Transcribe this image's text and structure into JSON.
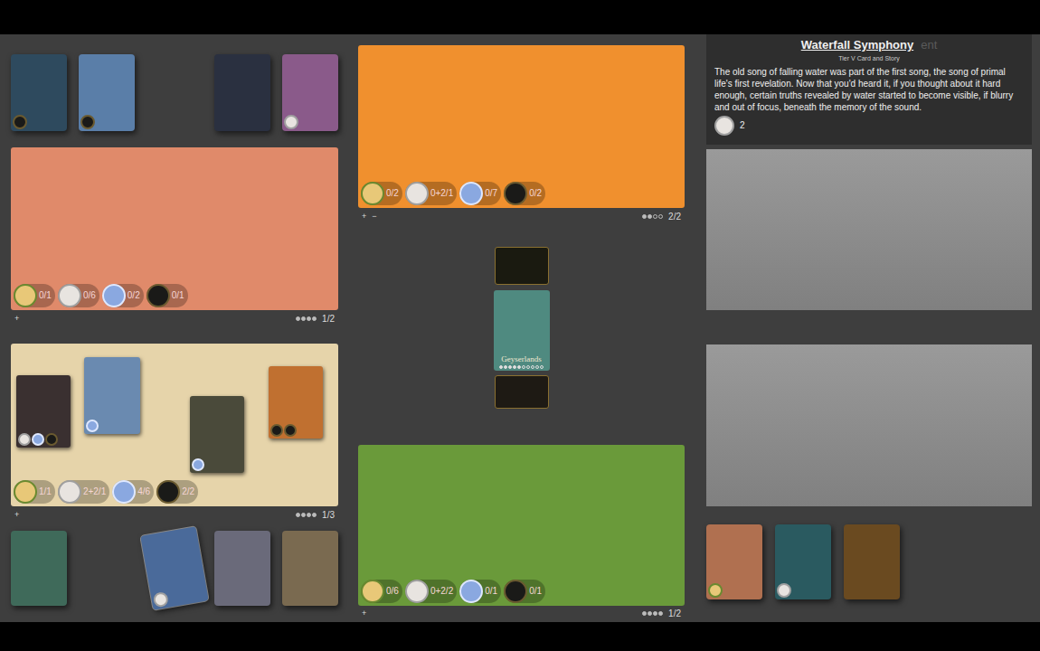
{
  "info": {
    "title": "Waterfall Symphony",
    "ghost": "ent",
    "subtitle": "Tier V Card and Story",
    "text": "The old song of falling water was part of the first song, the song of primal life's first revelation.  Now that you'd heard it, if you thought about it hard enough, certain truths revealed by water started to become visible, if blurry and out of focus, beneath the memory of the sound.",
    "cost": {
      "kind": "bird",
      "value": "2"
    }
  },
  "left_top_cards": [
    {
      "empty": false,
      "color": "#2e4a5e",
      "badge": "key"
    },
    {
      "empty": false,
      "color": "#5a7ea8",
      "badge": "key"
    },
    {
      "empty": true,
      "color": "#000000",
      "badge": "none"
    },
    {
      "empty": false,
      "color": "#2a3040",
      "badge": "none"
    },
    {
      "empty": false,
      "color": "#8a5a8a",
      "badge": "bird"
    }
  ],
  "left_bottom_cards": [
    {
      "empty": false,
      "color": "#3f6a5a",
      "badge": "none",
      "selected": false
    },
    {
      "empty": true,
      "color": "#000000",
      "badge": "none",
      "selected": false
    },
    {
      "empty": false,
      "color": "#4a6a9a",
      "badge": "bird",
      "selected": true
    },
    {
      "empty": false,
      "color": "#6a6a7a",
      "badge": "none",
      "selected": false
    },
    {
      "empty": false,
      "color": "#7a6a50",
      "badge": "none",
      "selected": false
    }
  ],
  "canyon": {
    "color": "#e08a6a",
    "tokens": [
      {
        "kind": "tree",
        "value": "0/1"
      },
      {
        "kind": "bird",
        "value": "0/6"
      },
      {
        "kind": "crystal",
        "value": "0/2"
      },
      {
        "kind": "key",
        "value": "0/1"
      }
    ],
    "controls": [
      "+"
    ],
    "pips": [
      true,
      true,
      true,
      true
    ],
    "count": "1/2"
  },
  "flowers": {
    "color": "#e6d4aa",
    "tokens": [
      {
        "kind": "tree",
        "value": "1/1"
      },
      {
        "kind": "bird",
        "value": "2+2/1"
      },
      {
        "kind": "crystal",
        "value": "4/6"
      },
      {
        "kind": "key",
        "value": "2/2"
      }
    ],
    "controls": [
      "+"
    ],
    "pips": [
      true,
      true,
      true,
      true
    ],
    "count": "1/3",
    "overlays": [
      {
        "color": "#3a3030",
        "tokens": [
          "bird",
          "crystal",
          "key"
        ]
      },
      {
        "color": "#6a8ab0",
        "tokens": [
          "crystal"
        ]
      },
      {
        "color": "#4a4a3a",
        "tokens": [
          "crystal"
        ]
      },
      {
        "color": "#c07030",
        "tokens": [
          "key",
          "key"
        ]
      }
    ]
  },
  "sun": {
    "color": "#f0902e",
    "tokens": [
      {
        "kind": "tree",
        "value": "0/2"
      },
      {
        "kind": "bird",
        "value": "0+2/1"
      },
      {
        "kind": "crystal",
        "value": "0/7"
      },
      {
        "kind": "key",
        "value": "0/2"
      }
    ],
    "controls": [
      "+",
      "−"
    ],
    "pips": [
      true,
      true,
      false,
      false
    ],
    "count": "2/2"
  },
  "center": {
    "top_color": "#1a1a10",
    "geyser": {
      "label": "Geyserlands",
      "color": "#4f8a80",
      "dots": [
        true,
        true,
        true,
        true,
        true,
        false,
        false,
        false,
        false,
        false
      ]
    },
    "deck_color": "#1e1a14"
  },
  "forest": {
    "color": "#6a9a3a",
    "tokens": [
      {
        "kind": "tree",
        "value": "0/6"
      },
      {
        "kind": "bird",
        "value": "0+2/2"
      },
      {
        "kind": "crystal",
        "value": "0/1"
      },
      {
        "kind": "key",
        "value": "0/1"
      }
    ],
    "controls": [
      "+"
    ],
    "pips": [
      true,
      true,
      true,
      true
    ],
    "count": "1/2"
  },
  "right_cards": [
    {
      "color": "#b07050",
      "badge": "tree"
    },
    {
      "color": "#2a5a60",
      "badge": "bird"
    },
    {
      "color": "#6a4a20",
      "badge": "none"
    }
  ]
}
